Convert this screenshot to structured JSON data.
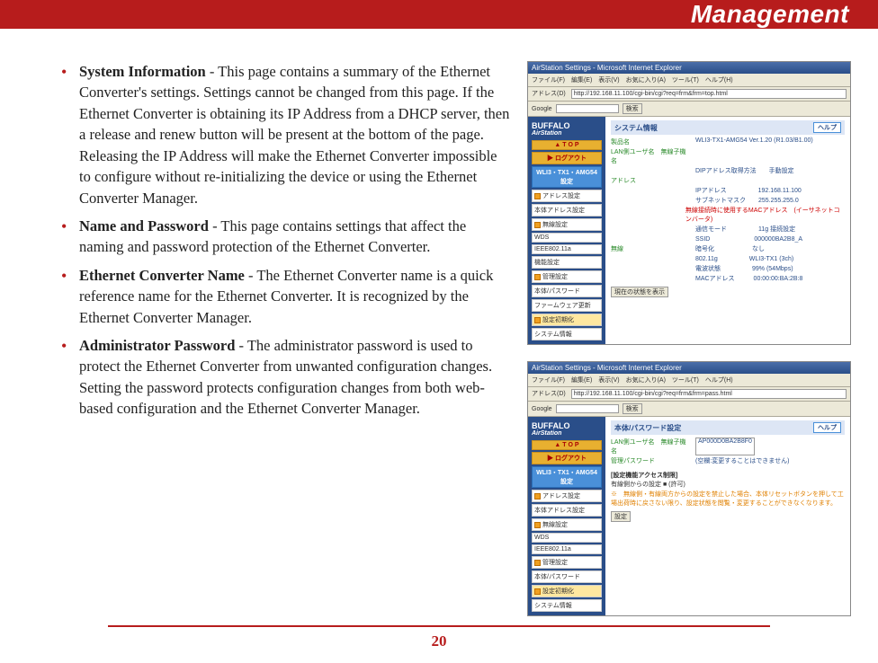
{
  "header": {
    "title": "Management"
  },
  "items": [
    {
      "title": "System Information",
      "text": " - This page contains a summary of the Ethernet Converter's settings.  Settings cannot be changed from this page.  If the Ethernet Converter is obtaining its IP Address from a DHCP server, then a release and renew button will be present at the bottom of the page.  Releasing the IP Address will make the Ethernet Converter impossible to configure without re-initializing the device or using the Ethernet Converter Manager."
    },
    {
      "title": "Name and Password",
      "text": " - This page contains settings that affect the naming and password protection of the Ethernet Converter."
    },
    {
      "title": "Ethernet Converter Name",
      "text": " - The Ethernet Converter name is a quick reference name for the Ethernet Converter.  It is recognized by the Ethernet Converter Manager."
    },
    {
      "title": "Administrator Password",
      "text": " - The administrator password is used to protect the Ethernet Converter from unwanted configuration changes.  Setting the password protects configuration changes from both web-based configuration and the Ethernet Converter Manager."
    }
  ],
  "page_number": "20",
  "screenshots": {
    "common": {
      "browser_title": "AirStation Settings - Microsoft Internet Explorer",
      "menu_bar": "ファイル(F)　編集(E)　表示(V)　お気に入り(A)　ツール(T)　ヘルプ(H)",
      "address_label": "アドレス(D)",
      "google_label": "Google",
      "google_search_btn": "検索",
      "brand_top": "BUFFALO",
      "brand_bottom": "AirStation",
      "btn_top": "▲ T O P",
      "btn_logout": "▶ ログアウト",
      "help_btn": "ヘルプ"
    },
    "shot1": {
      "address_url": "http://192.168.11.100/cgi-bin/cgi?req=frm&frm=top.html",
      "btn_blue": "WLI3・TX1・AMG54 設定",
      "panel_title": "システム情報",
      "menu": [
        "アドレス設定",
        "本体アドレス設定",
        "無線設定",
        "WDS",
        "IEEE802.11a",
        "機能設定",
        "管理設定",
        "本体/パスワード",
        "ファームウェア更新",
        "設定初期化",
        "システム情報"
      ],
      "rows": [
        {
          "k": "製品名",
          "v": "WLI3-TX1-AMG54 Ver.1.20 (R1.03/B1.00)"
        },
        {
          "k": "LAN側ユーザ名　無線子機名",
          "v": ""
        },
        {
          "k": "",
          "v": "DIPアドレス取得方法　　手動設定"
        },
        {
          "k": "アドレス",
          "v": ""
        },
        {
          "k": "",
          "v": "IPアドレス　　　　　192.168.11.100"
        },
        {
          "k": "",
          "v": "サブネットマスク　　255.255.255.0"
        },
        {
          "k": "",
          "v": "無線接続時に使用するMACアドレス　(イーサネットコンバータ)",
          "red": true
        },
        {
          "k": "",
          "v": "通信モード　　　　　11g 接続設定"
        },
        {
          "k": "",
          "v": "SSID　　　　　　　000000BA2B8_A"
        },
        {
          "k": "無線",
          "v": "暗号化　　　　　　なし"
        },
        {
          "k": "",
          "v": "802.11g　　　　　WLI3-TX1 (3ch)"
        },
        {
          "k": "",
          "v": "電波状態　　　　　99% (54Mbps)"
        },
        {
          "k": "",
          "v": "MACアドレス　　　00:00:00:BA:2B:8"
        }
      ],
      "refresh_btn": "現在の状態を表示"
    },
    "shot2": {
      "address_url": "http://192.168.11.100/cgi-bin/cgi?req=frm&frm=pass.html",
      "btn_blue": "WLI3・TX1・AMG54 設定",
      "panel_title": "本体/パスワード設定",
      "menu": [
        "アドレス設定",
        "本体アドレス設定",
        "無線設定",
        "WDS",
        "IEEE802.11a",
        "管理設定",
        "本体/パスワード",
        "設定初期化",
        "システム情報"
      ],
      "rows_top": [
        {
          "k": "LAN側ユーザ名　無線子機名",
          "v": "AP000D0BA2B8F0"
        },
        {
          "k": "管理パスワード",
          "v": "(空欄:変更することはできません)"
        }
      ],
      "note_title": "[設定機能アクセス制限]",
      "note_line": "有線側からの設定 ■ (許可)",
      "note_body": "※　無線側・有線両方からの設定を禁止した場合、本体リセットボタンを押して工場出荷時に戻さない限り、設定状態を閲覧・変更することができなくなります。",
      "set_btn": "設定"
    }
  }
}
